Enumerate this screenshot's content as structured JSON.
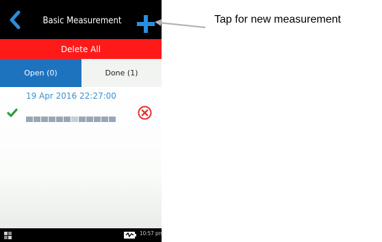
{
  "header": {
    "title": "Basic Measurement",
    "back_icon": "chevron-left-icon",
    "add_icon": "plus-icon",
    "accent": "#1e73be"
  },
  "toolbar": {
    "delete_all_label": "Delete All",
    "delete_color": "#ff1a1a"
  },
  "tabs": [
    {
      "label": "Open (0)",
      "active": true
    },
    {
      "label": "Done (1)",
      "active": false
    }
  ],
  "measurements": [
    {
      "datetime": "19 Apr 2016 22:27:00",
      "status_icon": "check-icon",
      "delete_icon": "close-circle-icon"
    }
  ],
  "statusbar": {
    "time": "10:57 pm",
    "battery_icon": "battery-charging-icon",
    "home_icon": "home-icon"
  },
  "callout": {
    "text": "Tap for new measurement"
  }
}
